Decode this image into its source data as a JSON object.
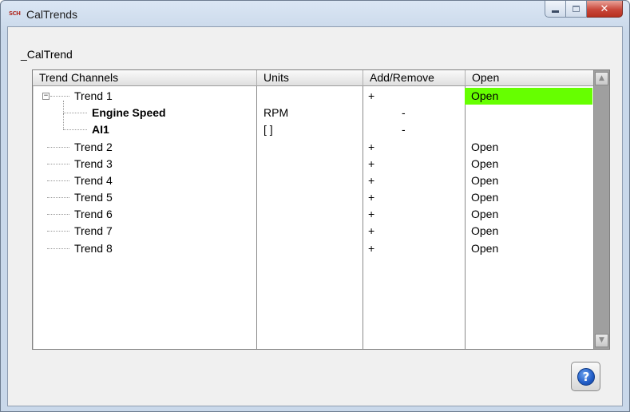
{
  "window": {
    "app_icon_text": "SCH",
    "title": "CalTrends",
    "minimize_glyph": "",
    "close_glyph": "✕"
  },
  "panel": {
    "label": "_CalTrend"
  },
  "tree": {
    "headers": {
      "channels": "Trend Channels",
      "units": "Units",
      "add_remove": "Add/Remove",
      "open": "Open"
    },
    "expander_glyph": "−",
    "scroll_up_glyph": "▲",
    "scroll_down_glyph": "▼",
    "rows": [
      {
        "name": "Trend 1",
        "units": "",
        "add": "+",
        "open": "Open",
        "highlight_color": "#66ff00"
      },
      {
        "name": "Engine Speed",
        "units": "RPM",
        "add": "-",
        "open": ""
      },
      {
        "name": "AI1",
        "units": "[ ]",
        "add": "-",
        "open": ""
      },
      {
        "name": "Trend 2",
        "units": "",
        "add": "+",
        "open": "Open"
      },
      {
        "name": "Trend 3",
        "units": "",
        "add": "+",
        "open": "Open"
      },
      {
        "name": "Trend 4",
        "units": "",
        "add": "+",
        "open": "Open"
      },
      {
        "name": "Trend 5",
        "units": "",
        "add": "+",
        "open": "Open"
      },
      {
        "name": "Trend 6",
        "units": "",
        "add": "+",
        "open": "Open"
      },
      {
        "name": "Trend 7",
        "units": "",
        "add": "+",
        "open": "Open"
      },
      {
        "name": "Trend 8",
        "units": "",
        "add": "+",
        "open": "Open"
      }
    ]
  },
  "help": {
    "glyph": "?"
  },
  "colors": {
    "open_highlight": "#66ff00",
    "help_blue": "#1f5bc6",
    "close_red": "#c8473a"
  }
}
